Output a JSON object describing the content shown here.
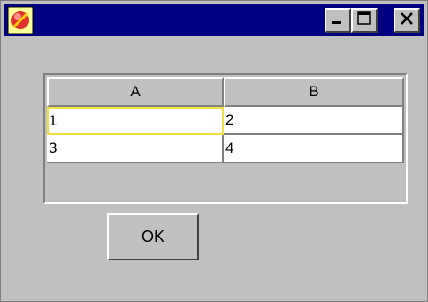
{
  "window": {
    "icon": "app-icon",
    "colors": {
      "titlebar": "#000080",
      "face": "#c0c0c0",
      "focus": "#f0e040"
    },
    "controls": {
      "minimize_icon": "minimize-icon",
      "maximize_icon": "maximize-icon",
      "close_icon": "close-icon"
    }
  },
  "table": {
    "columns": [
      "A",
      "B"
    ],
    "rows": [
      [
        "1",
        "2"
      ],
      [
        "3",
        "4"
      ]
    ]
  },
  "ok_label": "OK"
}
